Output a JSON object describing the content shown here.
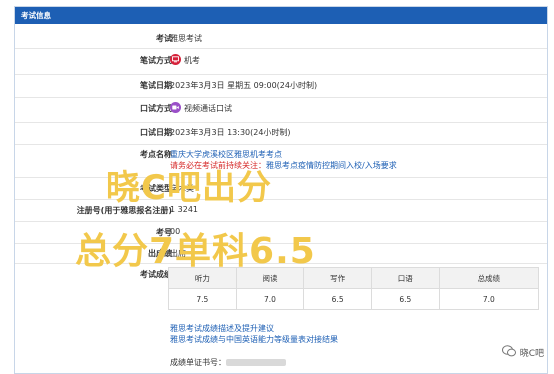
{
  "panel": {
    "title": "考试信息"
  },
  "rows": {
    "exam": {
      "label": "考试",
      "value": "雅思考试"
    },
    "written_mode": {
      "label": "笔试方式",
      "value": "机考",
      "icon": "computer-icon"
    },
    "written_date": {
      "label": "笔试日期",
      "value": "2023年3月3日 星期五 09:00(24小时制)"
    },
    "speaking_mode": {
      "label": "口试方式",
      "value": "视频通话口试",
      "icon": "video-call-icon"
    },
    "speaking_date": {
      "label": "口试日期",
      "value": "2023年3月3日 13:30(24小时制)"
    },
    "center": {
      "label": "考点名称",
      "value": "重庆大学虎溪校区雅思机考考点",
      "notice_red": "请务必在考试前持续关注：",
      "notice_link": "雅思考点疫情防控期间入校/入场要求"
    },
    "module": {
      "label": "考试类型",
      "value": "学术类"
    },
    "reg_no": {
      "label": "注册号(用于雅思报名注册)",
      "value": "1    3241"
    },
    "candidate": {
      "label": "考号",
      "value": "00"
    },
    "origin": {
      "label": "出成绩",
      "value": "出席"
    },
    "scores": {
      "label": "考试成绩"
    }
  },
  "score_table": {
    "headers": [
      "听力",
      "阅读",
      "写作",
      "口语",
      "总成绩"
    ],
    "values": [
      "7.5",
      "7.0",
      "6.5",
      "6.5",
      "7.0"
    ]
  },
  "links": {
    "desc": "雅思考试成绩描述及提升建议",
    "cefr": "雅思考试成绩与中国英语能力等级量表对接结果"
  },
  "report": {
    "label": "成绩单证书号："
  },
  "watermark": {
    "line1": "晓C吧出分",
    "line2": "总分7单科6.5"
  },
  "wechat": {
    "name": "晓C吧"
  }
}
